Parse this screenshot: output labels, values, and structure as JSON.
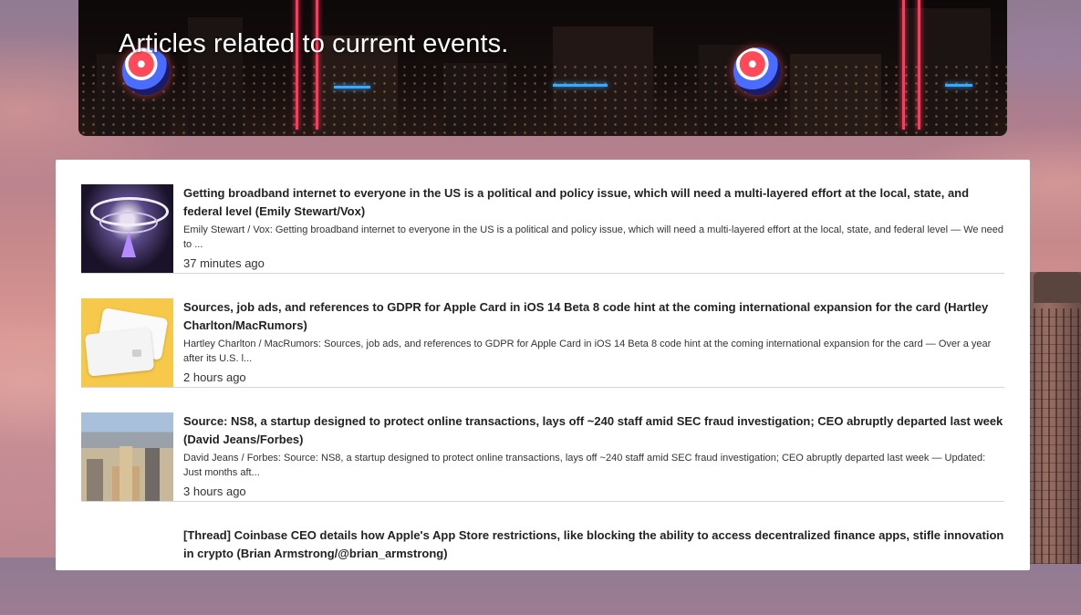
{
  "hero": {
    "title": "Articles related to current events."
  },
  "articles": [
    {
      "title": "Getting broadband internet to everyone in the US is a political and policy issue, which will need a multi-layered effort at the local, state, and federal level (Emily Stewart/Vox)",
      "summary": "Emily Stewart / Vox: Getting broadband internet to everyone in the US is a political and policy issue, which will need a multi-layered effort at the local, state, and federal level  —  We need to ...",
      "time": "37 minutes ago"
    },
    {
      "title": "Sources, job ads, and references to GDPR for Apple Card in iOS 14 Beta 8 code hint at the coming international expansion for the card (Hartley Charlton/MacRumors)",
      "summary": "Hartley Charlton / MacRumors: Sources, job ads, and references to GDPR for Apple Card in iOS 14 Beta 8 code hint at the coming international expansion for the card  —  Over a year after its U.S. l...",
      "time": "2 hours ago"
    },
    {
      "title": "Source: NS8, a startup designed to protect online transactions, lays off ~240 staff amid SEC fraud investigation; CEO abruptly departed last week (David Jeans/Forbes)",
      "summary": "David Jeans / Forbes: Source: NS8, a startup designed to protect online transactions, lays off ~240 staff amid SEC fraud investigation; CEO abruptly departed last week  —  Updated: Just months aft...",
      "time": "3 hours ago"
    },
    {
      "title": "[Thread] Coinbase CEO details how Apple's App Store restrictions, like blocking the ability to access decentralized finance apps, stifle innovation in crypto (Brian Armstrong/@brian_armstrong)"
    }
  ]
}
